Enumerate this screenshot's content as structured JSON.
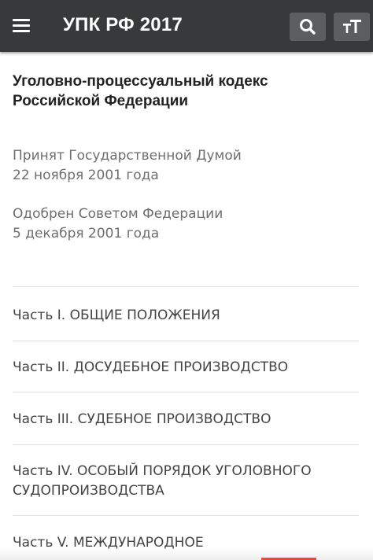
{
  "app_bar": {
    "title": "УПК РФ 2017",
    "background": "#37393b",
    "icons": {
      "menu": "hamburger-menu-icon",
      "search": "search-icon",
      "font_size": "text-size-icon"
    }
  },
  "document": {
    "title_line1": "Уголовно-процессуальный кодекс",
    "title_line2": "Российской Федерации",
    "adopted_line1": "Принят Государственной Думой",
    "adopted_line2": "22 ноября  2001 года",
    "approved_line1": "Одобрен Советом Федерации",
    "approved_line2": "5 декабря 2001 года"
  },
  "parts": [
    {
      "line1": "Часть I. ОБЩИЕ ПОЛОЖЕНИЯ"
    },
    {
      "line1": "Часть II. ДОСУДЕБНОЕ ПРОИЗВОДСТВО"
    },
    {
      "line1": "Часть III. СУДЕБНОЕ ПРОИЗВОДСТВО"
    },
    {
      "line1": "Часть IV. ОСОБЫЙ ПОРЯДОК УГОЛОВНОГО",
      "line2": "СУДОПРОИЗВОДСТВА"
    },
    {
      "line1": "Часть V. МЕЖДУНАРОДНОЕ"
    }
  ],
  "colors": {
    "accent": "#e94a3f",
    "icon_button_bg": "#5b5d60",
    "secondary_text": "#6e6e6e"
  }
}
